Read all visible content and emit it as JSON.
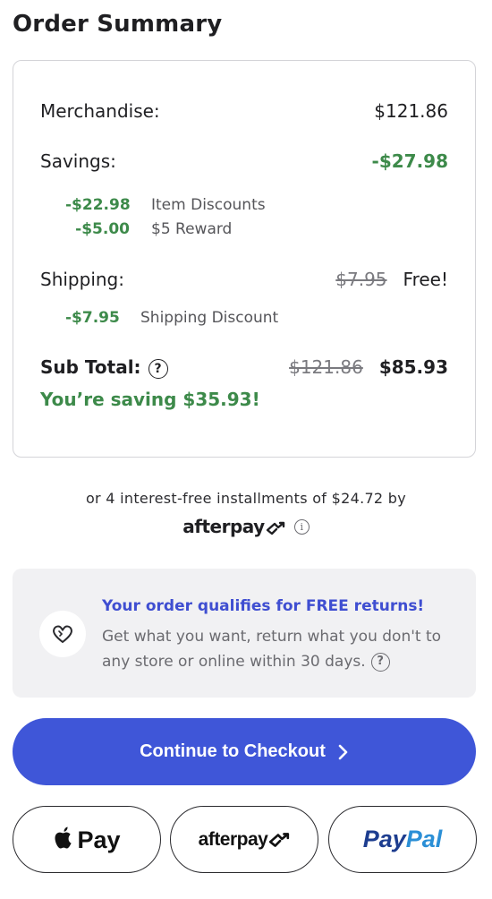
{
  "title": "Order Summary",
  "summary": {
    "merchandise_label": "Merchandise:",
    "merchandise_value": "$121.86",
    "savings_label": "Savings:",
    "savings_value": "-$27.98",
    "item_discount_amount": "-$22.98",
    "item_discount_label": "Item Discounts",
    "reward_amount": "-$5.00",
    "reward_label": "$5 Reward",
    "shipping_label": "Shipping:",
    "shipping_original": "$7.95",
    "shipping_value": "Free!",
    "shipping_discount_amount": "-$7.95",
    "shipping_discount_label": "Shipping Discount",
    "subtotal_label": "Sub Total:",
    "subtotal_original": "$121.86",
    "subtotal_value": "$85.93",
    "saving_message": "You’re saving $35.93!"
  },
  "afterpay": {
    "installments_text": "or 4 interest-free installments of $24.72 by",
    "logo_text": "afterpay"
  },
  "returns": {
    "title": "Your order qualifies for FREE returns!",
    "body": "Get what you want, return what you don't to any store or online within 30 days."
  },
  "checkout": {
    "label": "Continue to Checkout"
  },
  "payment_buttons": {
    "apple_pay": "Pay",
    "afterpay": "afterpay",
    "paypal_pay": "Pay",
    "paypal_pal": "Pal"
  },
  "colors": {
    "green": "#3d8a4a",
    "accent_blue": "#3f56d8",
    "returns_title": "#3f4ed1"
  },
  "icons": [
    "help-icon",
    "info-icon",
    "heart-icon",
    "chevron-right-icon",
    "apple-icon",
    "afterpay-logo-icon"
  ]
}
